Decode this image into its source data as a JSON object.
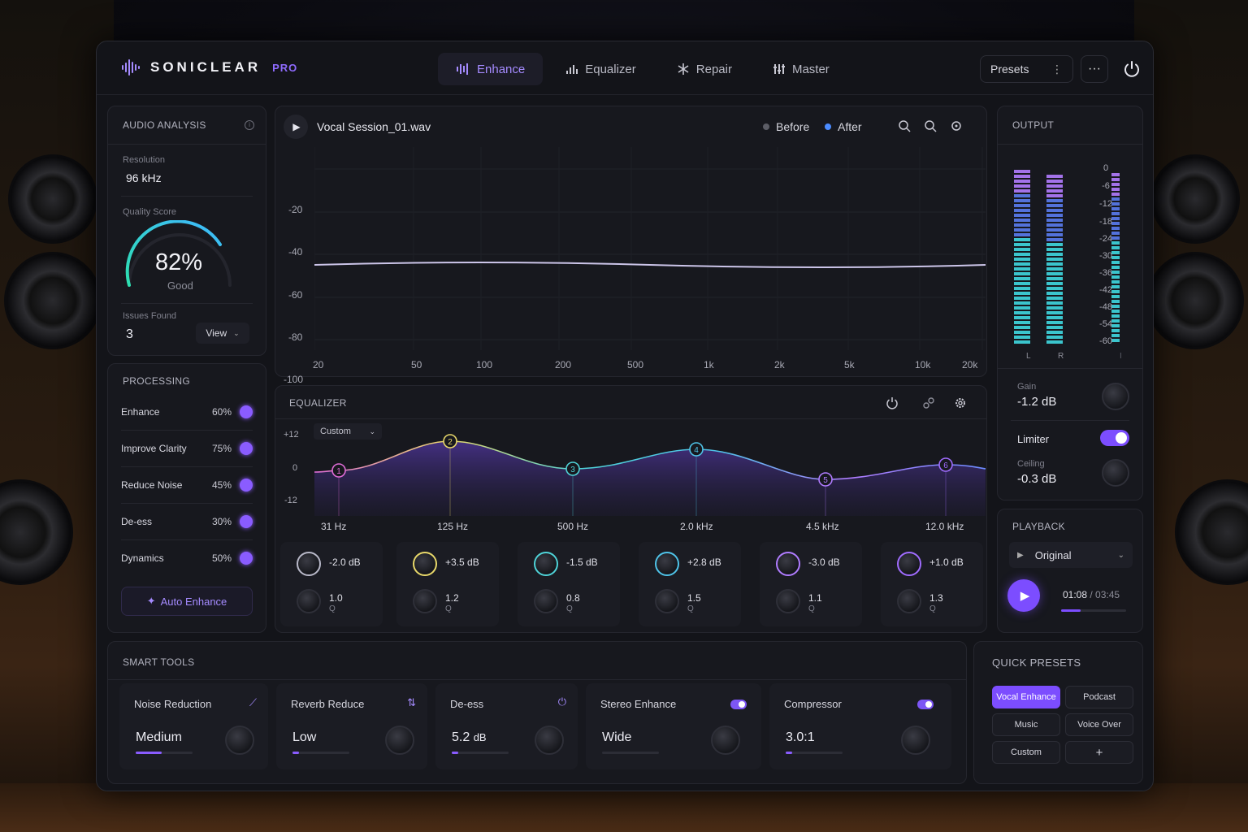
{
  "app": {
    "name": "SONICLEAR",
    "edition": "PRO"
  },
  "tabs": [
    {
      "label": "Enhance",
      "active": true,
      "icon": "waveform-icon"
    },
    {
      "label": "Equalizer",
      "active": false,
      "icon": "bars-icon"
    },
    {
      "label": "Repair",
      "active": false,
      "icon": "repair-icon"
    },
    {
      "label": "Master",
      "active": false,
      "icon": "sliders-icon"
    }
  ],
  "topbar": {
    "presets_label": "Presets",
    "more_label": "···"
  },
  "analysis": {
    "title": "AUDIO ANALYSIS",
    "resolution_label": "Resolution",
    "resolution_value": "96 kHz",
    "quality_label": "Quality Score",
    "quality_value": "82%",
    "quality_text": "Good",
    "quality_fraction": 0.82,
    "issues_label": "Issues Found",
    "issues_value": "3",
    "view_label": "View"
  },
  "processing": {
    "title": "PROCESSING",
    "items": [
      {
        "label": "Enhance",
        "value": "60%"
      },
      {
        "label": "Improve Clarity",
        "value": "75%"
      },
      {
        "label": "Reduce Noise",
        "value": "45%"
      },
      {
        "label": "De-ess",
        "value": "30%"
      },
      {
        "label": "Dynamics",
        "value": "50%"
      }
    ],
    "auto_label": "Auto Enhance"
  },
  "waveform": {
    "file_name": "Vocal Session_01.wav",
    "before_label": "Before",
    "after_label": "After",
    "y_ticks": [
      "-20",
      "-40",
      "-60",
      "-80",
      "-100"
    ],
    "x_ticks": [
      "20",
      "50",
      "100",
      "200",
      "500",
      "1k",
      "2k",
      "5k",
      "10k",
      "20k"
    ]
  },
  "equalizer": {
    "title": "EQUALIZER",
    "preset": "Custom",
    "y_ticks": [
      "+12",
      "0",
      "-12"
    ],
    "freq_labels": [
      "31 Hz",
      "125 Hz",
      "500 Hz",
      "2.0 kHz",
      "4.5 kHz",
      "12.0 kHz"
    ],
    "nodes": [
      "1",
      "2",
      "3",
      "4",
      "5",
      "6"
    ],
    "bands": [
      {
        "gain": "-2.0 dB",
        "q": "1.0",
        "q_label": "Q",
        "color": "#b8b8c8"
      },
      {
        "gain": "+3.5 dB",
        "q": "1.2",
        "q_label": "Q",
        "color": "#e8d86a"
      },
      {
        "gain": "-1.5 dB",
        "q": "0.8",
        "q_label": "Q",
        "color": "#4fd3d8"
      },
      {
        "gain": "+2.8 dB",
        "q": "1.5",
        "q_label": "Q",
        "color": "#4fc3e8"
      },
      {
        "gain": "-3.0 dB",
        "q": "1.1",
        "q_label": "Q",
        "color": "#b07cff"
      },
      {
        "gain": "+1.0 dB",
        "q": "1.3",
        "q_label": "Q",
        "color": "#a06cff"
      }
    ]
  },
  "output": {
    "title": "OUTPUT",
    "scale": [
      "0",
      "-6",
      "-12",
      "-18",
      "-24",
      "-30",
      "-36",
      "-42",
      "-48",
      "-54",
      "-60"
    ],
    "l_label": "L",
    "r_label": "R",
    "extra_label": "I",
    "gain_label": "Gain",
    "gain_value": "-1.2 dB",
    "limiter_label": "Limiter",
    "limiter_on": true,
    "ceiling_label": "Ceiling",
    "ceiling_value": "-0.3 dB"
  },
  "playback": {
    "title": "PLAYBACK",
    "source": "Original",
    "current_time": "01:08",
    "separator": " / ",
    "total_time": "03:45",
    "progress": 0.3
  },
  "smart_tools": {
    "title": "SMART TOOLS",
    "tools": [
      {
        "name": "Noise Reduction",
        "value": "Medium",
        "level": 0.45
      },
      {
        "name": "Reverb Reduce",
        "value": "Low",
        "level": 0.12
      },
      {
        "name": "De-ess",
        "value": "5.2",
        "unit": "dB",
        "level": 0.12
      },
      {
        "name": "Stereo Enhance",
        "value": "Wide",
        "level": 0.0
      },
      {
        "name": "Compressor",
        "value": "3.0:1",
        "level": 0.12
      }
    ]
  },
  "quick_presets": {
    "title": "QUICK PRESETS",
    "items": [
      "Vocal Enhance",
      "Podcast",
      "Music",
      "Voice Over",
      "Custom",
      "+"
    ],
    "active": "Vocal Enhance"
  },
  "colors": {
    "accent": "#8a5cff",
    "cyan": "#3fe0e8",
    "panel": "#17181e"
  }
}
